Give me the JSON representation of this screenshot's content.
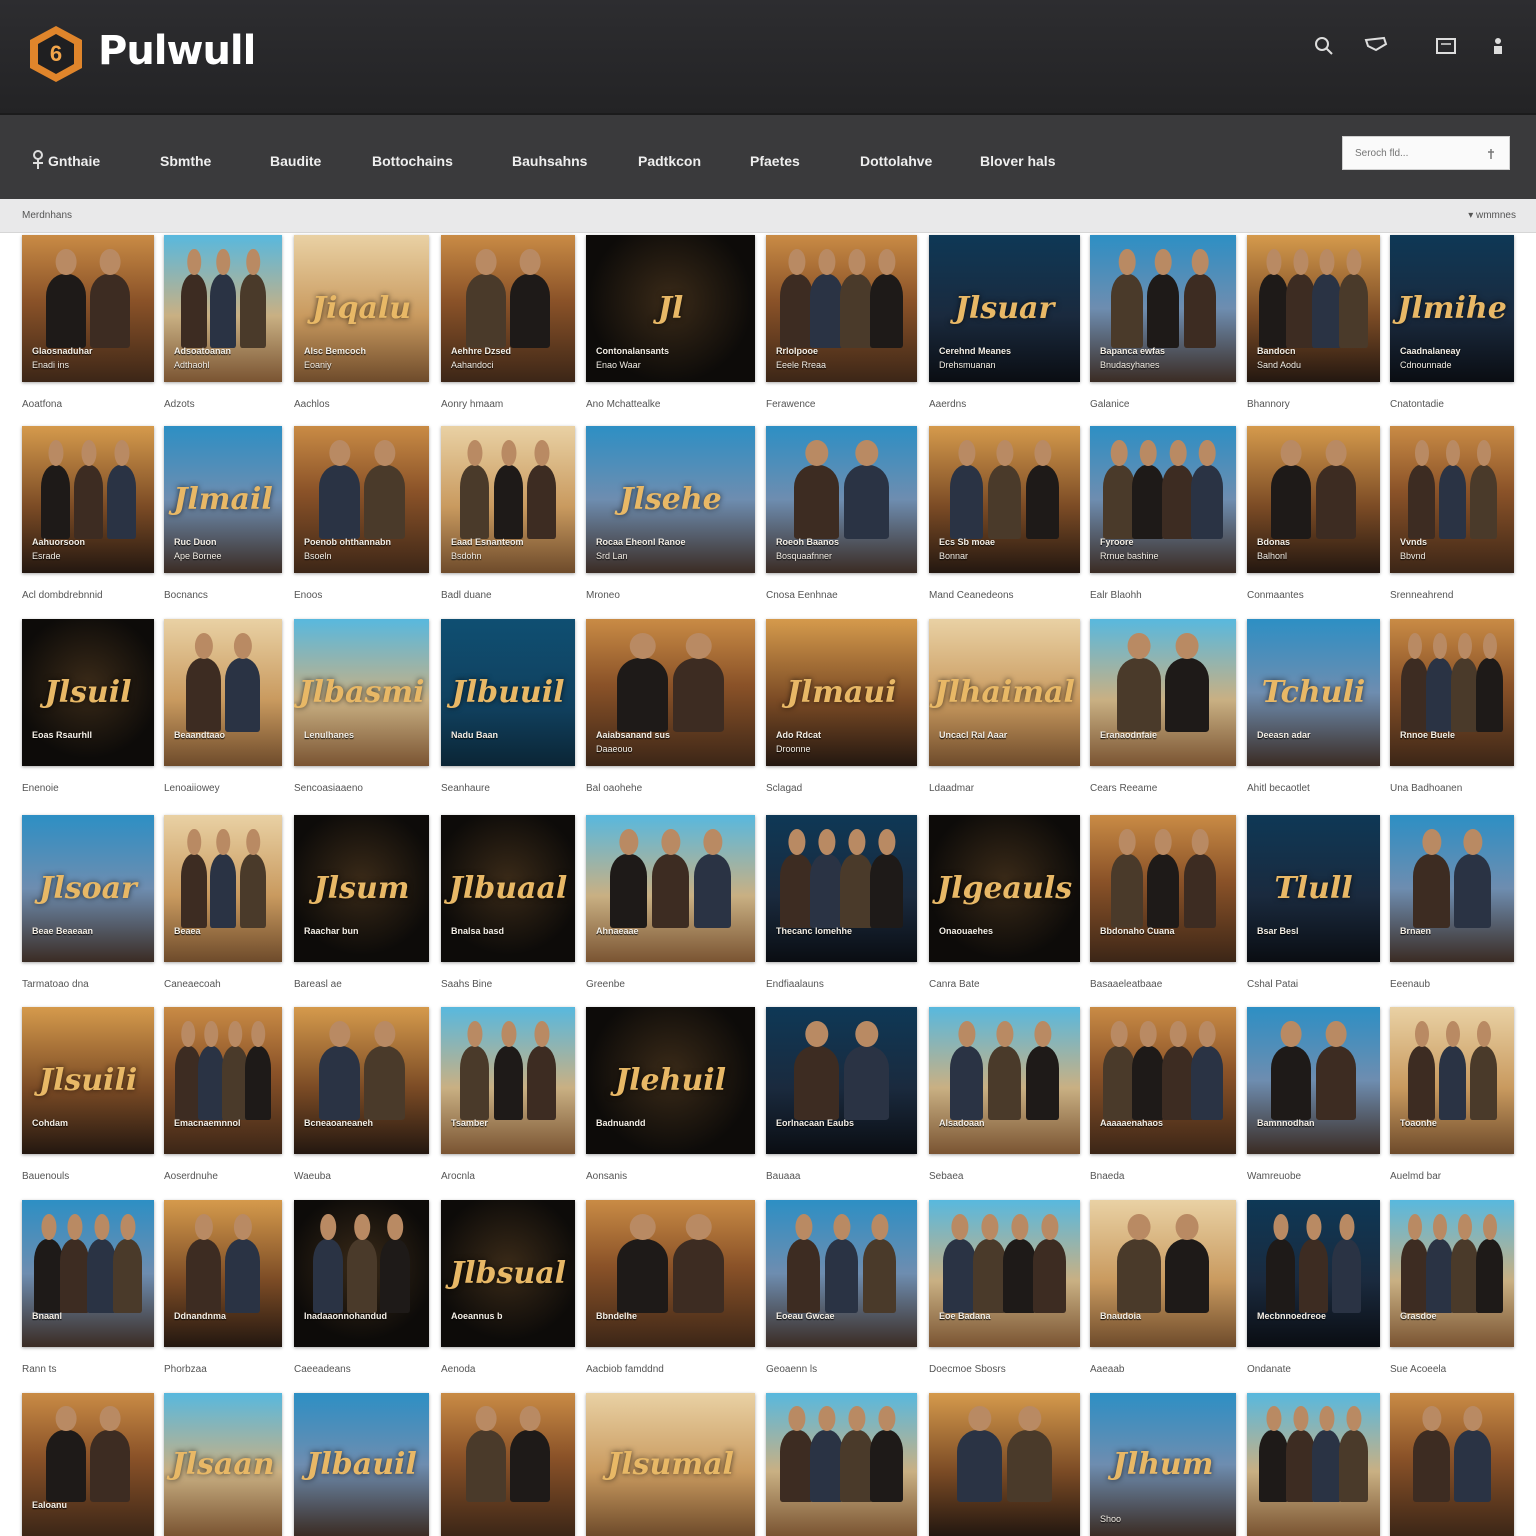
{
  "header": {
    "logo_badge": "6",
    "logo_text": "Pulwull",
    "icons": [
      "search-icon",
      "chat-icon",
      "window-icon",
      "person-icon"
    ]
  },
  "nav": {
    "items": [
      "Gnthaie",
      "Sbmthe",
      "Baudite",
      "Bottochains",
      "Bauhsahns",
      "Padtkcon",
      "Pfaetes",
      "Dottolahve",
      "Blover hals"
    ],
    "search_placeholder": "Seroch fld..."
  },
  "subbar": {
    "breadcrumb": "Merdnhans",
    "sort": "▾ wmmnes"
  },
  "colors": {
    "topbar": "#2a2a2c",
    "navbar": "#3a3a3c",
    "accent": "#e0852b",
    "gold": "#e8b866",
    "teal": "#1f6f9a"
  },
  "grid": {
    "rows": [
      {
        "titles": [
          "Aoatfona",
          "Adzots",
          "Aachlos",
          "Aonry hmaam",
          "Ano Mchattealke",
          "Ferawence",
          "Aaerdns",
          "Galanice",
          "Bhannory",
          "Cnatontadie"
        ],
        "posters": [
          {
            "theme": "warm",
            "calli": "",
            "cap1": "Glaosnaduhar",
            "cap2": "Enadi ins"
          },
          {
            "theme": "sky",
            "calli": "",
            "cap1": "Adsoatoanan",
            "cap2": "Adthaohl"
          },
          {
            "theme": "sand",
            "calli": "Jiqalu",
            "cap1": "Alsc Bemcoch",
            "cap2": "Eoaniy"
          },
          {
            "theme": "warm",
            "calli": "",
            "cap1": "Aehhre Dzsed",
            "cap2": "Aahandoci"
          },
          {
            "theme": "dark",
            "calli": "Jl",
            "cap1": "Contonalansants",
            "cap2": "Enao Waar"
          },
          {
            "theme": "warm",
            "calli": "",
            "cap1": "Rrlolpooe",
            "cap2": "Eeele Rreaa"
          },
          {
            "theme": "night",
            "calli": "Jlsuar",
            "cap1": "Cerehnd Meanes",
            "cap2": "Drehsmuanan"
          },
          {
            "theme": "blue",
            "calli": "",
            "cap1": "Bapanca ewfas",
            "cap2": "Bnudasyhanes"
          },
          {
            "theme": "amber",
            "calli": "",
            "cap1": "Bandocn",
            "cap2": "Sand Aodu"
          },
          {
            "theme": "night",
            "calli": "Jlmihe",
            "cap1": "Caadnalaneay",
            "cap2": "Cdnounnade"
          }
        ]
      },
      {
        "titles": [
          "Acl dombdrebnnid",
          "Bocnancs",
          "Enoos",
          "Badl duane",
          "Mroneo",
          "Cnosa Eenhnae",
          "Mand Ceanedeons",
          "Ealr Blaohh",
          "Conmaantes",
          "Srenneahrend"
        ],
        "posters": [
          {
            "theme": "amber",
            "calli": "",
            "cap1": "Aahuorsoon",
            "cap2": "Esrade"
          },
          {
            "theme": "blue",
            "calli": "Jlmail",
            "cap1": "Ruc Duon",
            "cap2": "Ape Bornee"
          },
          {
            "theme": "warm",
            "calli": "",
            "cap1": "Poenob ohthannabn",
            "cap2": "Bsoeln"
          },
          {
            "theme": "sand",
            "calli": "",
            "cap1": "Eaad Esnanteom",
            "cap2": "Bsdohn"
          },
          {
            "theme": "blue",
            "calli": "Jlsehe",
            "cap1": "Rocaa Eheonl Ranoe",
            "cap2": "Srd Lan"
          },
          {
            "theme": "blue",
            "calli": "",
            "cap1": "Roeoh Baanos",
            "cap2": "Bosquaafnner"
          },
          {
            "theme": "amber",
            "calli": "",
            "cap1": "Ecs Sb moae",
            "cap2": "Bonnar"
          },
          {
            "theme": "blue",
            "calli": "",
            "cap1": "Fyroore",
            "cap2": "Rrnue bashine"
          },
          {
            "theme": "amber",
            "calli": "",
            "cap1": "Bdonas",
            "cap2": "Balhonl"
          },
          {
            "theme": "warm",
            "calli": "",
            "cap1": "Vvnds",
            "cap2": "Bbvnd"
          }
        ]
      },
      {
        "titles": [
          "Enenoie",
          "Lenoaiiowey",
          "Sencoasiaaeno",
          "Seanhaure",
          "Bal oaohehe",
          "Sclagad",
          "Ldaadmar",
          "Cears Reeame",
          "Ahitl becaotlet",
          "Una Badhoanen"
        ],
        "posters": [
          {
            "theme": "dark",
            "calli": "Jlsuil",
            "cap1": "Eoas Rsaurhll",
            "cap2": ""
          },
          {
            "theme": "sand",
            "calli": "",
            "cap1": "Beaandtaao",
            "cap2": ""
          },
          {
            "theme": "sky",
            "calli": "Jlbasmi",
            "cap1": "Lenulhanes",
            "cap2": ""
          },
          {
            "theme": "teal",
            "calli": "Jlbuuil",
            "cap1": "Nadu Baan",
            "cap2": ""
          },
          {
            "theme": "warm",
            "calli": "",
            "cap1": "Aaiabsanand sus",
            "cap2": "Daaeouo"
          },
          {
            "theme": "amber",
            "calli": "Jlmaui",
            "cap1": "Ado Rdcat",
            "cap2": "Droonne"
          },
          {
            "theme": "sand",
            "calli": "Jlhaimal",
            "cap1": "Uncacl Ral Aaar",
            "cap2": ""
          },
          {
            "theme": "sky",
            "calli": "",
            "cap1": "Eranaodnfaie",
            "cap2": ""
          },
          {
            "theme": "blue",
            "calli": "Tchuli",
            "cap1": "Deeasn adar",
            "cap2": ""
          },
          {
            "theme": "warm",
            "calli": "",
            "cap1": "Rnnoe Buele",
            "cap2": ""
          }
        ]
      },
      {
        "titles": [
          "Tarmatoao dna",
          "Caneaecoah",
          "Bareasl ae",
          "Saahs Bine",
          "Greenbe",
          "Endfiaalauns",
          "Canra Bate",
          "Basaaeleatbaae",
          "Cshal Patai",
          "Eeenaub"
        ],
        "posters": [
          {
            "theme": "blue",
            "calli": "Jlsoar",
            "cap1": "Beae Beaeaan",
            "cap2": ""
          },
          {
            "theme": "sand",
            "calli": "",
            "cap1": "Beaea",
            "cap2": ""
          },
          {
            "theme": "dark",
            "calli": "Jlsum",
            "cap1": "Raachar bun",
            "cap2": ""
          },
          {
            "theme": "dark",
            "calli": "Jlbuaal",
            "cap1": "Bnalsa basd",
            "cap2": ""
          },
          {
            "theme": "sky",
            "calli": "",
            "cap1": "Ahnaeaae",
            "cap2": ""
          },
          {
            "theme": "night",
            "calli": "",
            "cap1": "Thecanc lomehhe",
            "cap2": ""
          },
          {
            "theme": "dark",
            "calli": "Jlgeauls",
            "cap1": "Onaouaehes",
            "cap2": ""
          },
          {
            "theme": "warm",
            "calli": "",
            "cap1": "Bbdonaho Cuana",
            "cap2": ""
          },
          {
            "theme": "night",
            "calli": "Tlull",
            "cap1": "Bsar Besl",
            "cap2": ""
          },
          {
            "theme": "blue",
            "calli": "",
            "cap1": "Brnaen",
            "cap2": ""
          }
        ]
      },
      {
        "titles": [
          "Bauenouls",
          "Aoserdnuhe",
          "Waeuba",
          "Arocnla",
          "Aonsanis",
          "Bauaaa",
          "Sebaea",
          "Bnaeda",
          "Wamreuobe",
          "Auelmd bar"
        ],
        "posters": [
          {
            "theme": "amber",
            "calli": "Jlsuili",
            "cap1": "Cohdam",
            "cap2": ""
          },
          {
            "theme": "warm",
            "calli": "",
            "cap1": "Emacnaemnnol",
            "cap2": ""
          },
          {
            "theme": "amber",
            "calli": "",
            "cap1": "Bcneaoaneaneh",
            "cap2": ""
          },
          {
            "theme": "sky",
            "calli": "",
            "cap1": "Tsamber",
            "cap2": ""
          },
          {
            "theme": "dark",
            "calli": "Jlehuil",
            "cap1": "Badnuandd",
            "cap2": ""
          },
          {
            "theme": "night",
            "calli": "",
            "cap1": "Eorlnacaan Eaubs",
            "cap2": ""
          },
          {
            "theme": "sky",
            "calli": "",
            "cap1": "Alsadoaan",
            "cap2": ""
          },
          {
            "theme": "warm",
            "calli": "",
            "cap1": "Aaaaaenahaos",
            "cap2": ""
          },
          {
            "theme": "blue",
            "calli": "",
            "cap1": "Bamnnodhan",
            "cap2": ""
          },
          {
            "theme": "sand",
            "calli": "",
            "cap1": "Toaonhe",
            "cap2": ""
          }
        ]
      },
      {
        "titles": [
          "Rann ts",
          "Phorbzaa",
          "Caeeadeans",
          "Aenoda",
          "Aacbiob famddnd",
          "Geoaenn ls",
          "Doecmoe Sbosrs",
          "Aaeaab",
          "Ondanate",
          "Sue Acoeela"
        ],
        "posters": [
          {
            "theme": "blue",
            "calli": "",
            "cap1": "Bnaanl",
            "cap2": ""
          },
          {
            "theme": "amber",
            "calli": "",
            "cap1": "Ddnandnma",
            "cap2": ""
          },
          {
            "theme": "dark",
            "calli": "",
            "cap1": "Inadaaonnohandud",
            "cap2": ""
          },
          {
            "theme": "dark",
            "calli": "Jlbsual",
            "cap1": "Aoeannus b",
            "cap2": ""
          },
          {
            "theme": "warm",
            "calli": "",
            "cap1": "Bbndelhe",
            "cap2": ""
          },
          {
            "theme": "blue",
            "calli": "",
            "cap1": "Eoeau Gwcae",
            "cap2": ""
          },
          {
            "theme": "sky",
            "calli": "",
            "cap1": "Eoe Badana",
            "cap2": ""
          },
          {
            "theme": "sand",
            "calli": "",
            "cap1": "Bnaudoia",
            "cap2": ""
          },
          {
            "theme": "night",
            "calli": "",
            "cap1": "Mecbnnoedreoe",
            "cap2": ""
          },
          {
            "theme": "sky",
            "calli": "",
            "cap1": "Grasdoe",
            "cap2": ""
          }
        ]
      },
      {
        "titles": [],
        "posters": [
          {
            "theme": "warm",
            "calli": "",
            "cap1": "Ealoanu",
            "cap2": ""
          },
          {
            "theme": "sky",
            "calli": "Jlsaan",
            "cap1": "",
            "cap2": ""
          },
          {
            "theme": "blue",
            "calli": "Jlbauil",
            "cap1": "",
            "cap2": ""
          },
          {
            "theme": "warm",
            "calli": "",
            "cap1": "",
            "cap2": ""
          },
          {
            "theme": "sand",
            "calli": "Jlsumal",
            "cap1": "",
            "cap2": ""
          },
          {
            "theme": "sky",
            "calli": "",
            "cap1": "",
            "cap2": ""
          },
          {
            "theme": "amber",
            "calli": "",
            "cap1": "",
            "cap2": ""
          },
          {
            "theme": "blue",
            "calli": "Jlhum",
            "cap1": "",
            "cap2": "Shoo"
          },
          {
            "theme": "sky",
            "calli": "",
            "cap1": "",
            "cap2": ""
          },
          {
            "theme": "warm",
            "calli": "",
            "cap1": "",
            "cap2": ""
          }
        ]
      }
    ]
  }
}
